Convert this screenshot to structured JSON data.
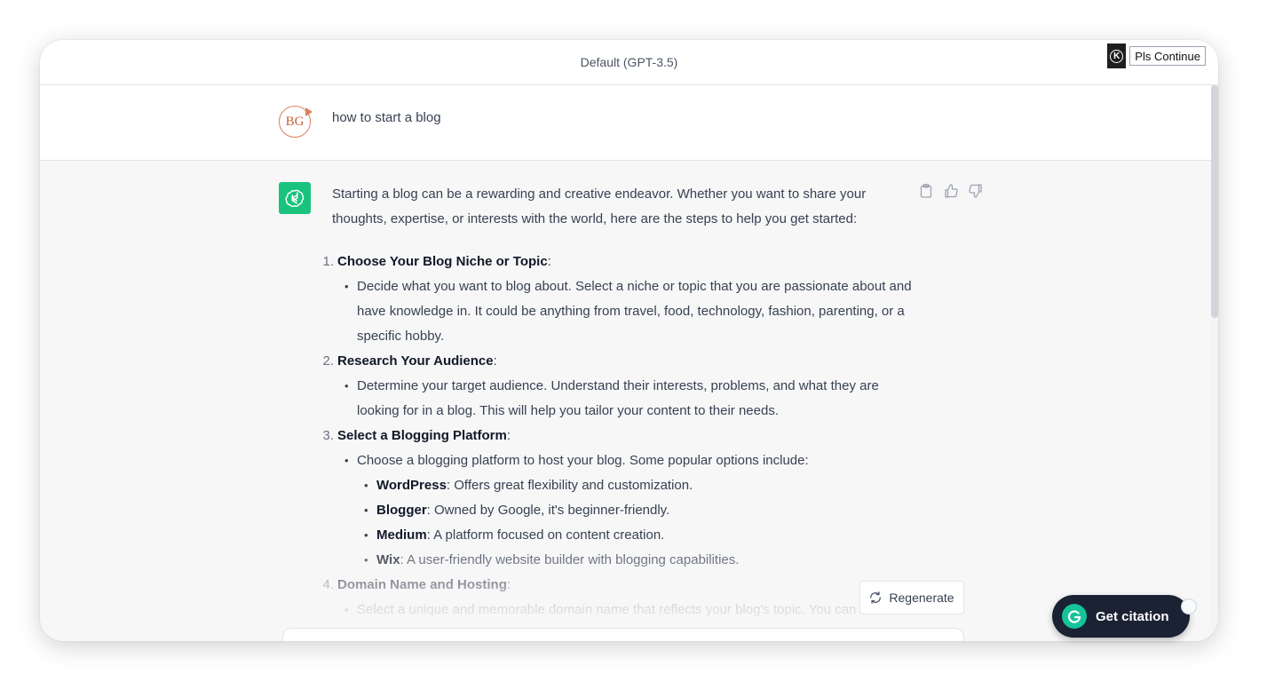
{
  "header": {
    "model_label": "Default (GPT-3.5)",
    "extension_icon": "K",
    "extension_button": "Pls Continue"
  },
  "user_message": {
    "avatar_initials": "BG",
    "text": "how to start a blog"
  },
  "assistant_message": {
    "avatar_icon": "openai-logo-icon",
    "intro": "Starting a blog can be a rewarding and creative endeavor. Whether you want to share your thoughts, expertise, or interests with the world, here are the steps to help you get started:",
    "steps": [
      {
        "num": "1.",
        "title": "Choose Your Blog Niche or Topic",
        "bullet": "Decide what you want to blog about. Select a niche or topic that you are passionate about and have knowledge in. It could be anything from travel, food, technology, fashion, parenting, or a specific hobby."
      },
      {
        "num": "2.",
        "title": "Research Your Audience",
        "bullet": "Determine your target audience. Understand their interests, problems, and what they are looking for in a blog. This will help you tailor your content to their needs."
      },
      {
        "num": "3.",
        "title": "Select a Blogging Platform",
        "bullet": "Choose a blogging platform to host your blog. Some popular options include:",
        "platforms": [
          {
            "name": "WordPress",
            "desc": ": Offers great flexibility and customization."
          },
          {
            "name": "Blogger",
            "desc": ": Owned by Google, it's beginner-friendly."
          },
          {
            "name": "Medium",
            "desc": ": A platform focused on content creation."
          },
          {
            "name": "Wix",
            "desc": ": A user-friendly website builder with blogging capabilities."
          }
        ]
      },
      {
        "num": "4.",
        "title": "Domain Name and Hosting",
        "bullet": "Select a unique and memorable domain name that reflects your blog's topic. You can"
      }
    ]
  },
  "actions": {
    "copy_icon": "clipboard-icon",
    "like_icon": "thumbs-up-icon",
    "dislike_icon": "thumbs-down-icon"
  },
  "regenerate_label": "Regenerate",
  "citation_button": "Get citation",
  "colors": {
    "gpt_green": "#19c37d",
    "citation_bg": "#1a2233",
    "grammarly_green": "#15c39a"
  }
}
